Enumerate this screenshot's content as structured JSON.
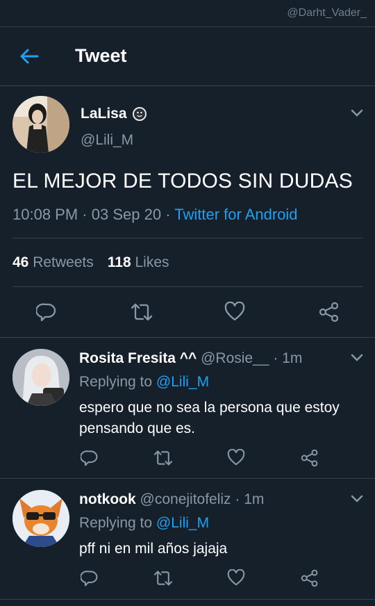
{
  "watermark": "@Darht_Vader_",
  "appbar": {
    "title": "Tweet"
  },
  "tweet": {
    "name": "LaLisa",
    "handle": "@Lili_M",
    "text": "EL MEJOR DE TODOS SIN DUDAS",
    "time": "10:08 PM",
    "date": "03 Sep 20",
    "source": "Twitter for Android",
    "retweets_count": "46",
    "retweets_label": "Retweets",
    "likes_count": "118",
    "likes_label": "Likes"
  },
  "replies": [
    {
      "name": "Rosita Fresita ^^",
      "handle": "@Rosie__",
      "time": "1m",
      "replying_label": "Replying to",
      "replying_to": "@Lili_M",
      "text": "espero que no sea la persona que estoy pensando que es."
    },
    {
      "name": "notkook",
      "handle": "@conejitofeliz",
      "time": "1m",
      "replying_label": "Replying to",
      "replying_to": "@Lili_M",
      "text": "pff ni en mil años jajaja"
    }
  ],
  "colors": {
    "background": "#15202b",
    "accent": "#1da1f2",
    "secondary_text": "#8899a6",
    "border": "#38444d"
  },
  "icons": {
    "back": "arrow-left-icon",
    "more": "chevron-down-icon",
    "reply": "reply-icon",
    "retweet": "retweet-icon",
    "like": "heart-icon",
    "share": "share-icon"
  }
}
